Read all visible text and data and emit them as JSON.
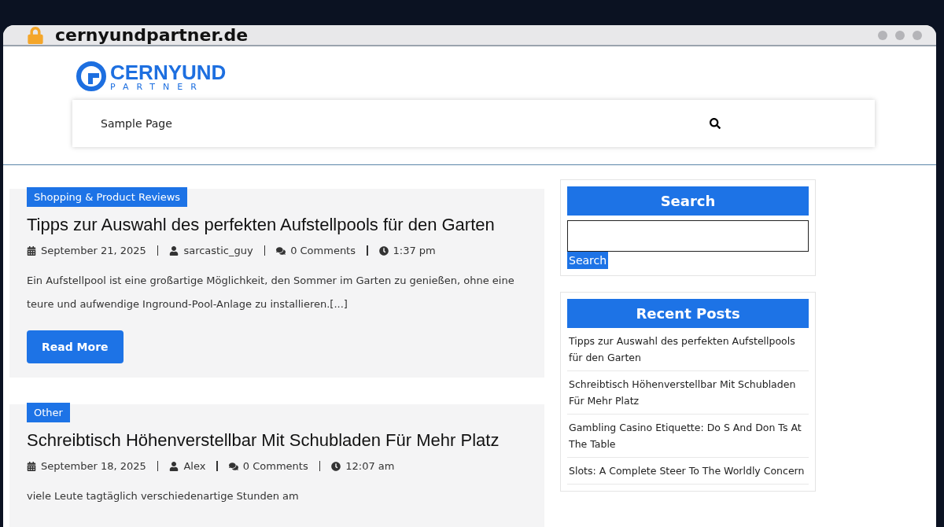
{
  "browser": {
    "address": "cernyundpartner.de",
    "secure": true
  },
  "site": {
    "logo_top": "CERNYUND",
    "logo_bottom": "PARTNER",
    "nav": [
      {
        "label": "Sample Page",
        "selected": false
      }
    ]
  },
  "posts": [
    {
      "category": "Shopping & Product Reviews",
      "title": "Tipps zur Auswahl des perfekten Aufstellpools für den Garten",
      "date": "September 21, 2025",
      "author": "sarcastic_guy",
      "comments": "0 Comments",
      "time": "1:37 pm",
      "excerpt": "Ein Aufstellpool ist eine großartige Möglichkeit, den Sommer im Garten zu genießen, ohne eine teure und aufwendige Inground-Pool-Anlage zu installieren.[...]",
      "button": "Read More"
    },
    {
      "category": "Other",
      "title": "Schreibtisch Höhenverstellbar Mit Schubladen Für Mehr Platz",
      "date": "September 18, 2025",
      "author": "Alex",
      "comments": "0 Comments",
      "time": "12:07 am",
      "excerpt": "viele Leute tagtäglich verschiedenartige Stunden am"
    }
  ],
  "sidebar": {
    "search": {
      "heading": "Search",
      "button": "Search"
    },
    "recent": {
      "heading": "Recent Posts",
      "items": [
        "Tipps zur Auswahl des perfekten Aufstellpools für den Garten",
        "Schreibtisch Höhenverstellbar Mit Schubladen Für Mehr Platz",
        "Gambling Casino Etiquette: Do S And Don Ts At The Table",
        "Slots: A Complete Steer To The Worldly Concern"
      ]
    }
  }
}
